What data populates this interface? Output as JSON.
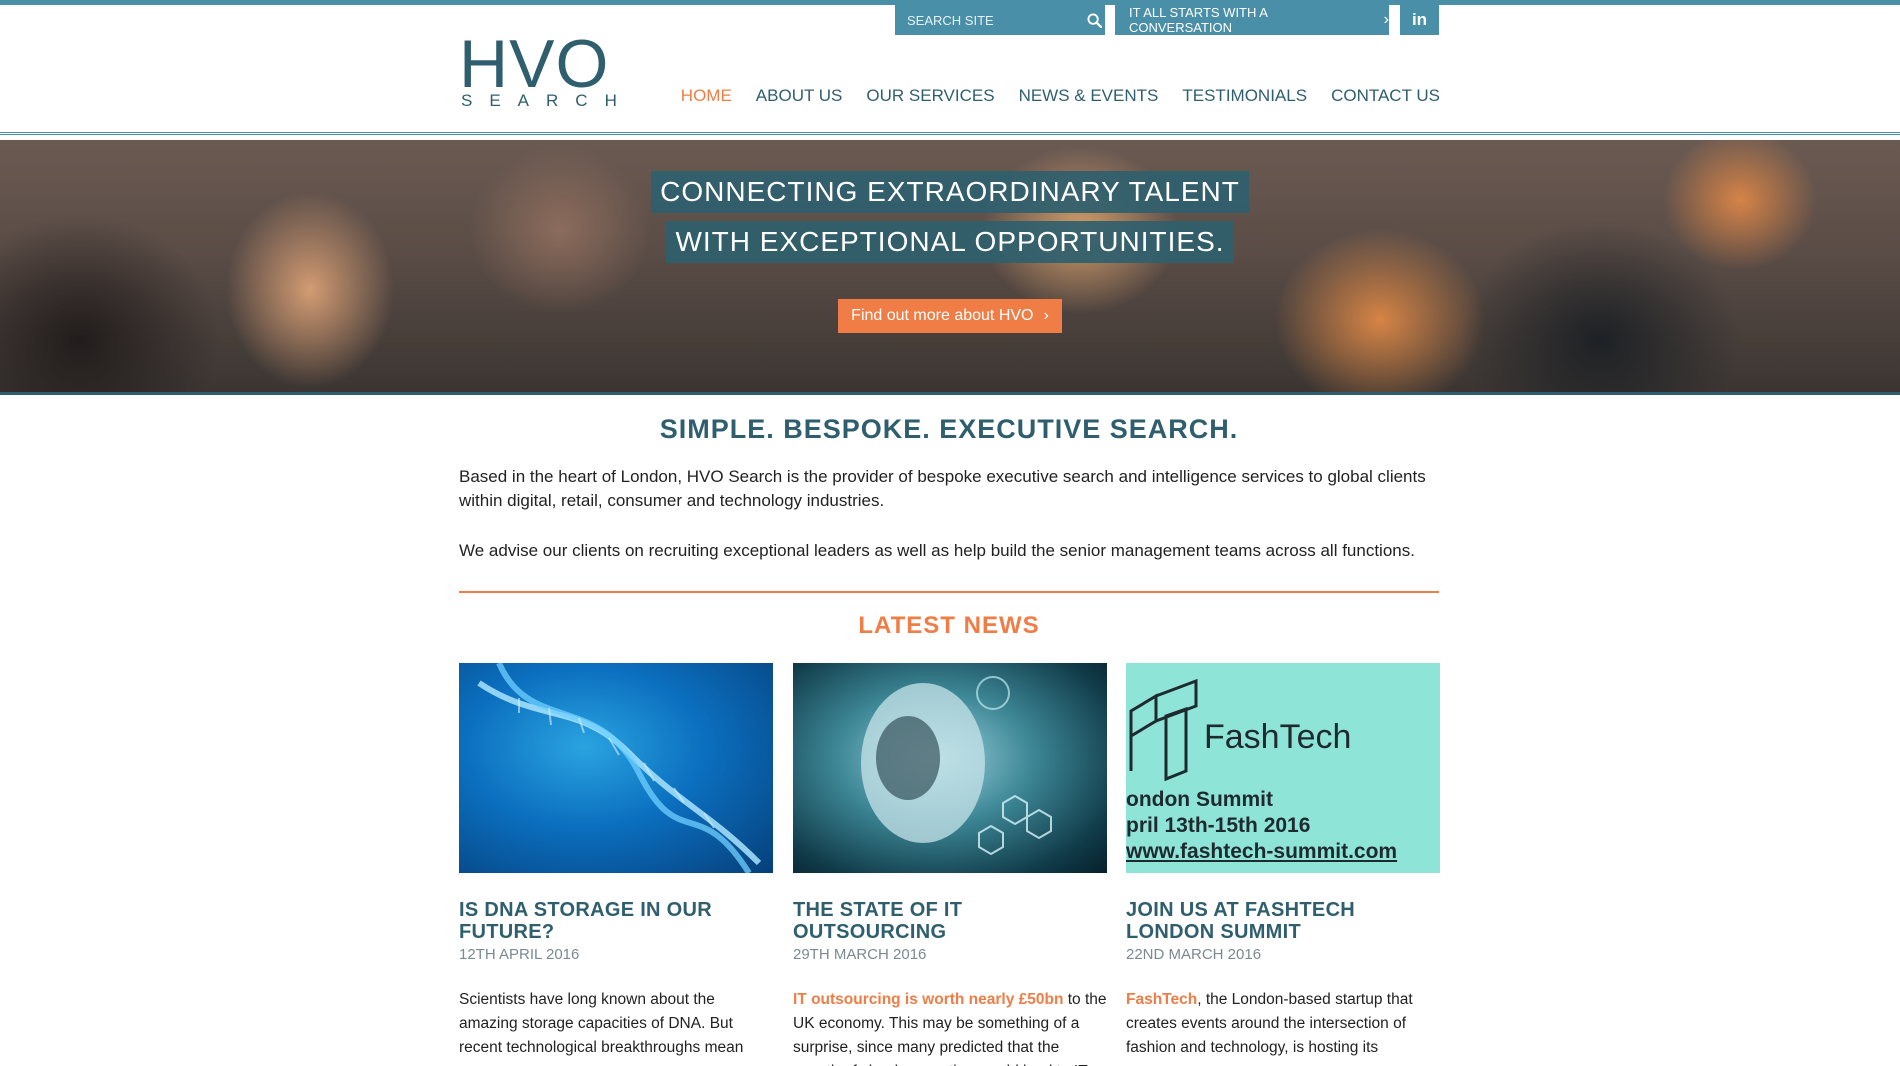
{
  "brand": {
    "logo_main": "HVO",
    "logo_sub": "SEARCH"
  },
  "topbar": {
    "search_placeholder": "SEARCH SITE",
    "conversation_label": "IT ALL STARTS WITH A CONVERSATION",
    "linkedin_label": "in"
  },
  "nav": {
    "items": [
      {
        "label": "HOME"
      },
      {
        "label": "ABOUT US"
      },
      {
        "label": "OUR SERVICES"
      },
      {
        "label": "NEWS & EVENTS"
      },
      {
        "label": "TESTIMONIALS"
      },
      {
        "label": "CONTACT US"
      }
    ],
    "active": "HOME"
  },
  "hero": {
    "line1": "CONNECTING EXTRAORDINARY TALENT",
    "line2": "WITH EXCEPTIONAL OPPORTUNITIES.",
    "cta": "Find out more about HVO"
  },
  "intro": {
    "tagline": "SIMPLE. BESPOKE. EXECUTIVE SEARCH.",
    "p1": "Based in the heart of London, HVO Search is the provider of bespoke executive search and intelligence services to global clients within digital, retail, consumer and technology industries.",
    "p2": "We advise our clients on recruiting exceptional leaders as well as help build the senior management teams across all functions."
  },
  "news": {
    "heading": "LATEST NEWS",
    "items": [
      {
        "title": "IS DNA STORAGE IN OUR FUTURE?",
        "date": "12TH APRIL 2016",
        "highlight": "",
        "text": "Scientists have long known about the amazing storage capacities of DNA. But recent technological breakthroughs mean"
      },
      {
        "title": "THE STATE OF IT OUTSOURCING",
        "date": "29TH MARCH 2016",
        "highlight": "IT outsourcing is worth nearly £50bn",
        "text": " to the UK economy. This may be something of a surprise, since many predicted that the growth of cloud computing would lead to IT"
      },
      {
        "title": "JOIN US AT FASHTECH LONDON SUMMIT",
        "date": "22ND MARCH 2016",
        "highlight": "FashTech",
        "text": ", the London-based startup that creates events around the intersection of fashion and technology, is hosting its",
        "image_text": {
          "brand": "FashTech",
          "line1": "ondon Summit",
          "line2": "pril 13th-15th 2016",
          "line3": "www.fashtech-summit.com"
        }
      }
    ]
  },
  "colors": {
    "teal": "#4a8fa8",
    "dark_teal": "#2f5f6e",
    "orange": "#f07d45",
    "fashtech_bg": "#8ee4d6"
  }
}
